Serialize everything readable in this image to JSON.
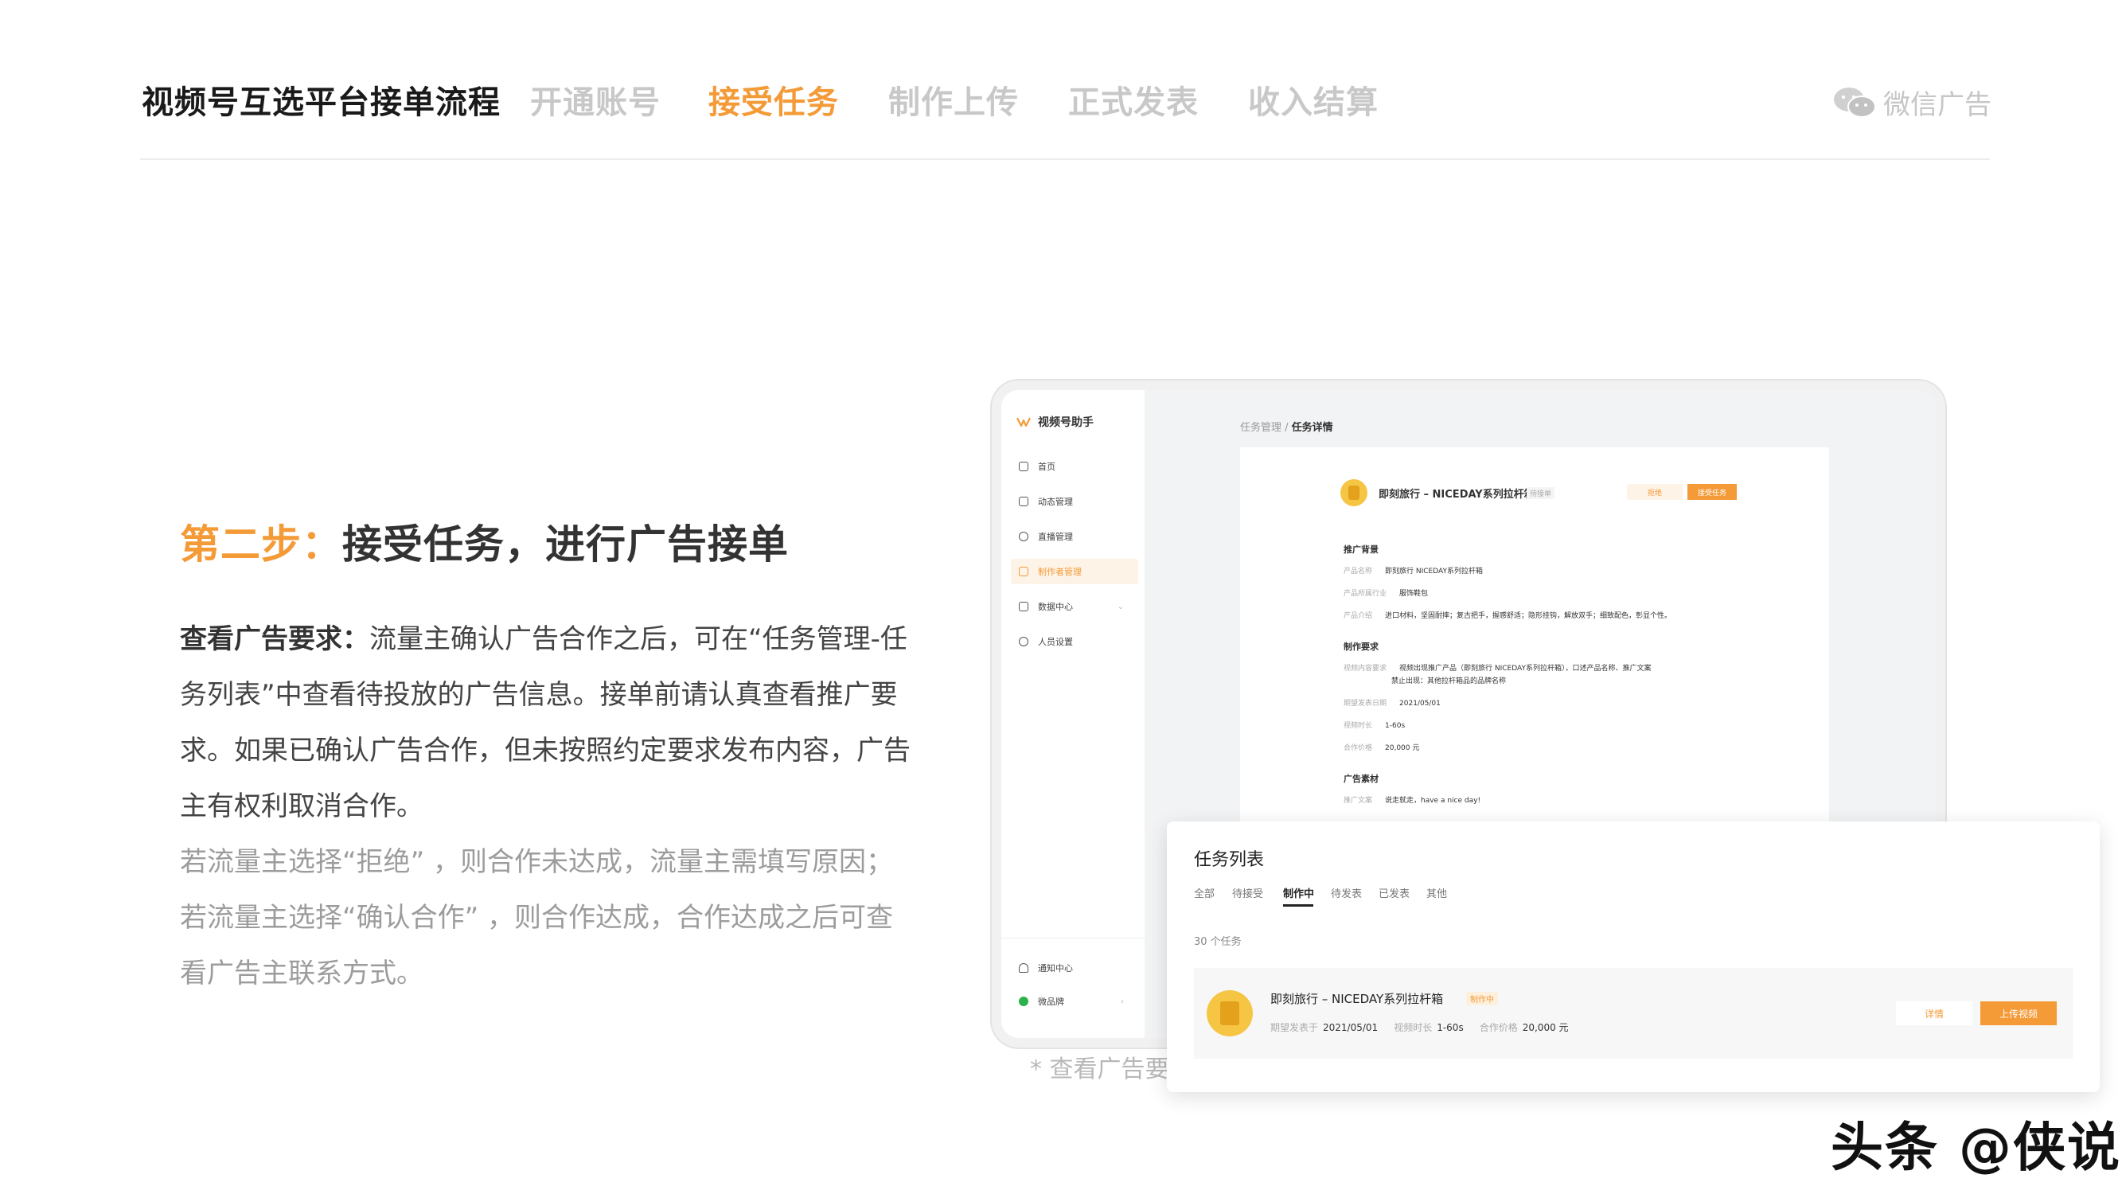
{
  "header": {
    "title": "视频号互选平台接单流程",
    "steps": [
      "开通账号",
      "接受任务",
      "制作上传",
      "正式发表",
      "收入结算"
    ],
    "active_step": 1,
    "brand": "微信广告"
  },
  "content": {
    "heading_step": "第二步：",
    "heading_text": "接受任务，进行广告接单",
    "desc_label": "查看广告要求：",
    "desc_text": "流量主确认广告合作之后，可在“任务管理-任务列表”中查看待投放的广告信息。接单前请认真查看推广要求。如果已确认广告合作，但未按照约定要求发布内容，广告主有权利取消合作。",
    "note_line1": "若流量主选择“拒绝” ，则合作未达成，流量主需填写原因；",
    "note_line2": "若流量主选择“确认合作” ，则合作达成，合作达成之后可查看广告主联系方式。",
    "caption": "* 查看广告要求"
  },
  "app": {
    "name": "视频号助手",
    "sidebar": [
      {
        "label": "首页",
        "icon": "home-icon"
      },
      {
        "label": "动态管理",
        "icon": "camera-icon"
      },
      {
        "label": "直播管理",
        "icon": "live-icon"
      },
      {
        "label": "制作者管理",
        "icon": "creator-icon",
        "active": true
      },
      {
        "label": "数据中心",
        "icon": "chart-icon"
      },
      {
        "label": "人员设置",
        "icon": "user-icon"
      }
    ],
    "sidebar_bottom": [
      {
        "label": "通知中心",
        "icon": "bell-icon"
      },
      {
        "label": "微品牌",
        "icon": "brand-icon"
      }
    ],
    "breadcrumb_parent": "任务管理 /",
    "breadcrumb_current": "任务详情",
    "detail": {
      "title": "即刻旅行 – NICEDAY系列拉杆箱",
      "badge": "待接单",
      "reject_label": "拒绝",
      "accept_label": "接受任务",
      "sections": [
        {
          "title": "推广背景",
          "rows": [
            [
              "产品名称",
              "即刻旅行 NICEDAY系列拉杆箱"
            ],
            [
              "产品所属行业",
              "服饰鞋包"
            ],
            [
              "产品介绍",
              "进口材料，坚固耐摔；复古把手，握感舒适；隐形挂钩，解放双手；细致配色，彰显个性。"
            ]
          ]
        },
        {
          "title": "制作要求",
          "rows": [
            [
              "视频内容要求",
              "视频出现推广产品（即刻旅行 NICEDAY系列拉杆箱），口述产品名称、推广文案"
            ],
            [
              "",
              "禁止出现：其他拉杆箱品的品牌名称"
            ],
            [
              "期望发表日期",
              "2021/05/01"
            ],
            [
              "视频时长",
              "1-60s"
            ],
            [
              "合作价格",
              "20,000 元"
            ]
          ]
        },
        {
          "title": "广告素材",
          "rows": [
            [
              "推广文案",
              "说走就走，have a nice day!"
            ]
          ]
        }
      ]
    }
  },
  "task_list": {
    "title": "任务列表",
    "tabs": [
      "全部",
      "待接受",
      "制作中",
      "待发表",
      "已发表",
      "其他"
    ],
    "active_tab": 2,
    "count": "30 个任务",
    "row": {
      "title": "即刻旅行 – NICEDAY系列拉杆箱",
      "badge": "制作中",
      "meta_date_label": "期望发表于",
      "meta_date": "2021/05/01",
      "meta_len_label": "视频时长",
      "meta_len": "1-60s",
      "meta_price_label": "合作价格",
      "meta_price": "20,000 元",
      "detail_btn": "详情",
      "upload_btn": "上传视频"
    }
  },
  "watermark": "头条 @侠说",
  "colors": {
    "accent": "#f49a37",
    "muted": "#c8c8c8"
  }
}
